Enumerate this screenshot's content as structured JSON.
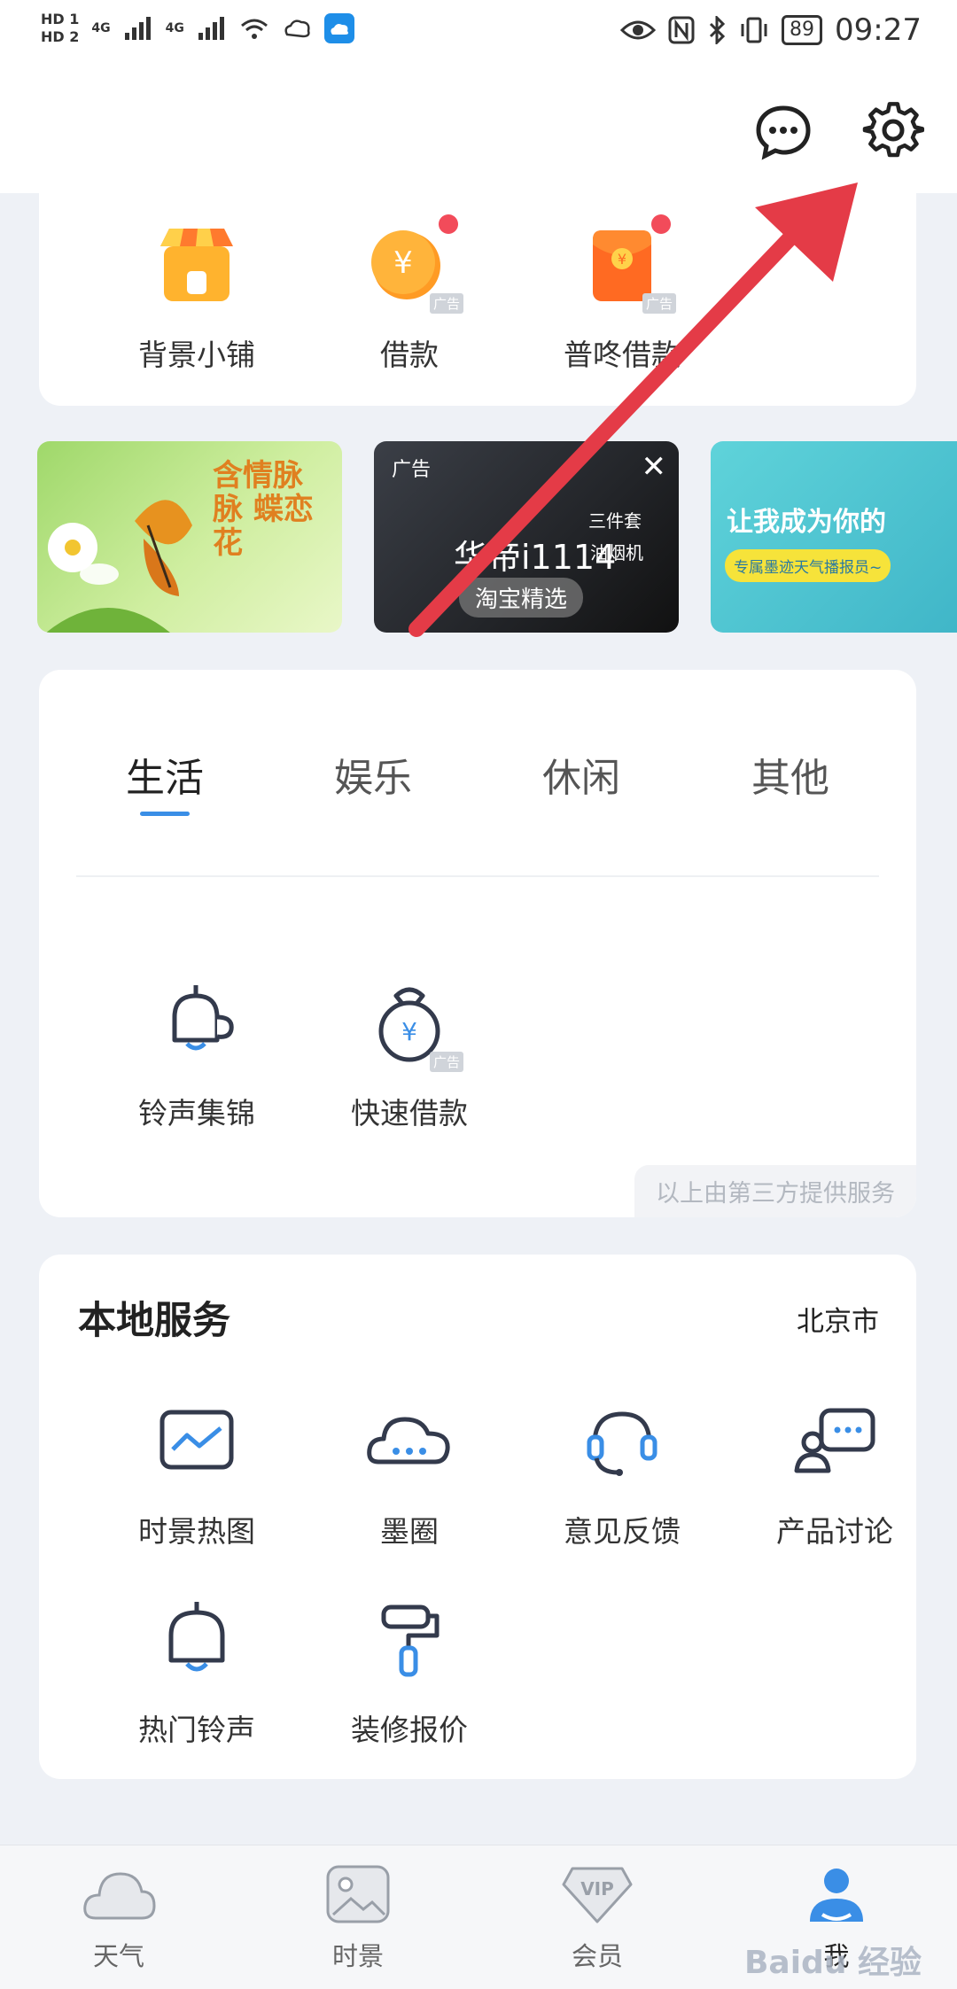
{
  "status_bar": {
    "sim1": "HD 1",
    "sim2": "HD 2",
    "net1": "4G",
    "net2": "4G",
    "battery": "89",
    "time": "09:27"
  },
  "quick_services": [
    {
      "label": "背景小铺"
    },
    {
      "label": "借款",
      "ad": "广告"
    },
    {
      "label": "普咚借款",
      "ad": "广告"
    }
  ],
  "banners": {
    "b1_text": "含情脉脉 蝶恋花",
    "b2_ad": "广告",
    "b2_title": "华帝i1114",
    "b2_sub": "三件套",
    "b2_sub2": "油烟机",
    "b2_tag": "淘宝精选",
    "b3_title": "让我成为你的",
    "b3_sub": "专属墨迹天气播报员~"
  },
  "tabs": [
    "生活",
    "娱乐",
    "休闲",
    "其他"
  ],
  "life_services": [
    {
      "label": "铃声集锦"
    },
    {
      "label": "快速借款",
      "ad": "广告"
    }
  ],
  "third_party_note": "以上由第三方提供服务",
  "local": {
    "title": "本地服务",
    "city": "北京市",
    "items": [
      {
        "label": "时景热图"
      },
      {
        "label": "墨圈"
      },
      {
        "label": "意见反馈"
      },
      {
        "label": "产品讨论"
      },
      {
        "label": "热门铃声"
      },
      {
        "label": "装修报价"
      }
    ]
  },
  "nav": [
    {
      "label": "天气"
    },
    {
      "label": "时景"
    },
    {
      "label": "会员",
      "badge": "VIP"
    },
    {
      "label": "我"
    }
  ],
  "watermark": "Baidu 经验",
  "colors": {
    "accent": "#3a8ee6",
    "arrow": "#e43b47"
  }
}
